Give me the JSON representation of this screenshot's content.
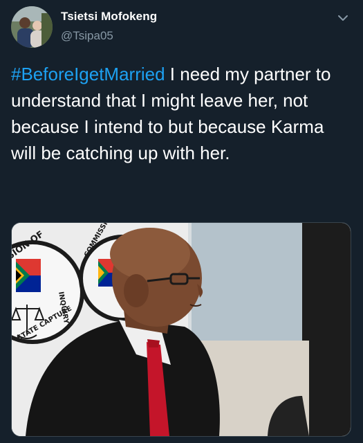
{
  "tweet": {
    "author_name": "Tsietsi Mofokeng",
    "author_handle": "@Tsipa05",
    "hashtag": "#BeforeIgetMarried",
    "text": " I need my partner to understand that I might leave her, not because I intend to but because Karma will be catching up with her.",
    "menu_icon": "chevron-down-icon",
    "avatar_icon": "avatar",
    "media": {
      "icon": "photo-image",
      "seal_texts": [
        "SION OF",
        "INQUIRY",
        "STATE CAPTURE",
        "COMMISSION OF"
      ]
    }
  },
  "colors": {
    "background": "#15202b",
    "text": "#ffffff",
    "secondary_text": "#8899a6",
    "hashtag": "#1da1f2",
    "border": "#38444d"
  }
}
